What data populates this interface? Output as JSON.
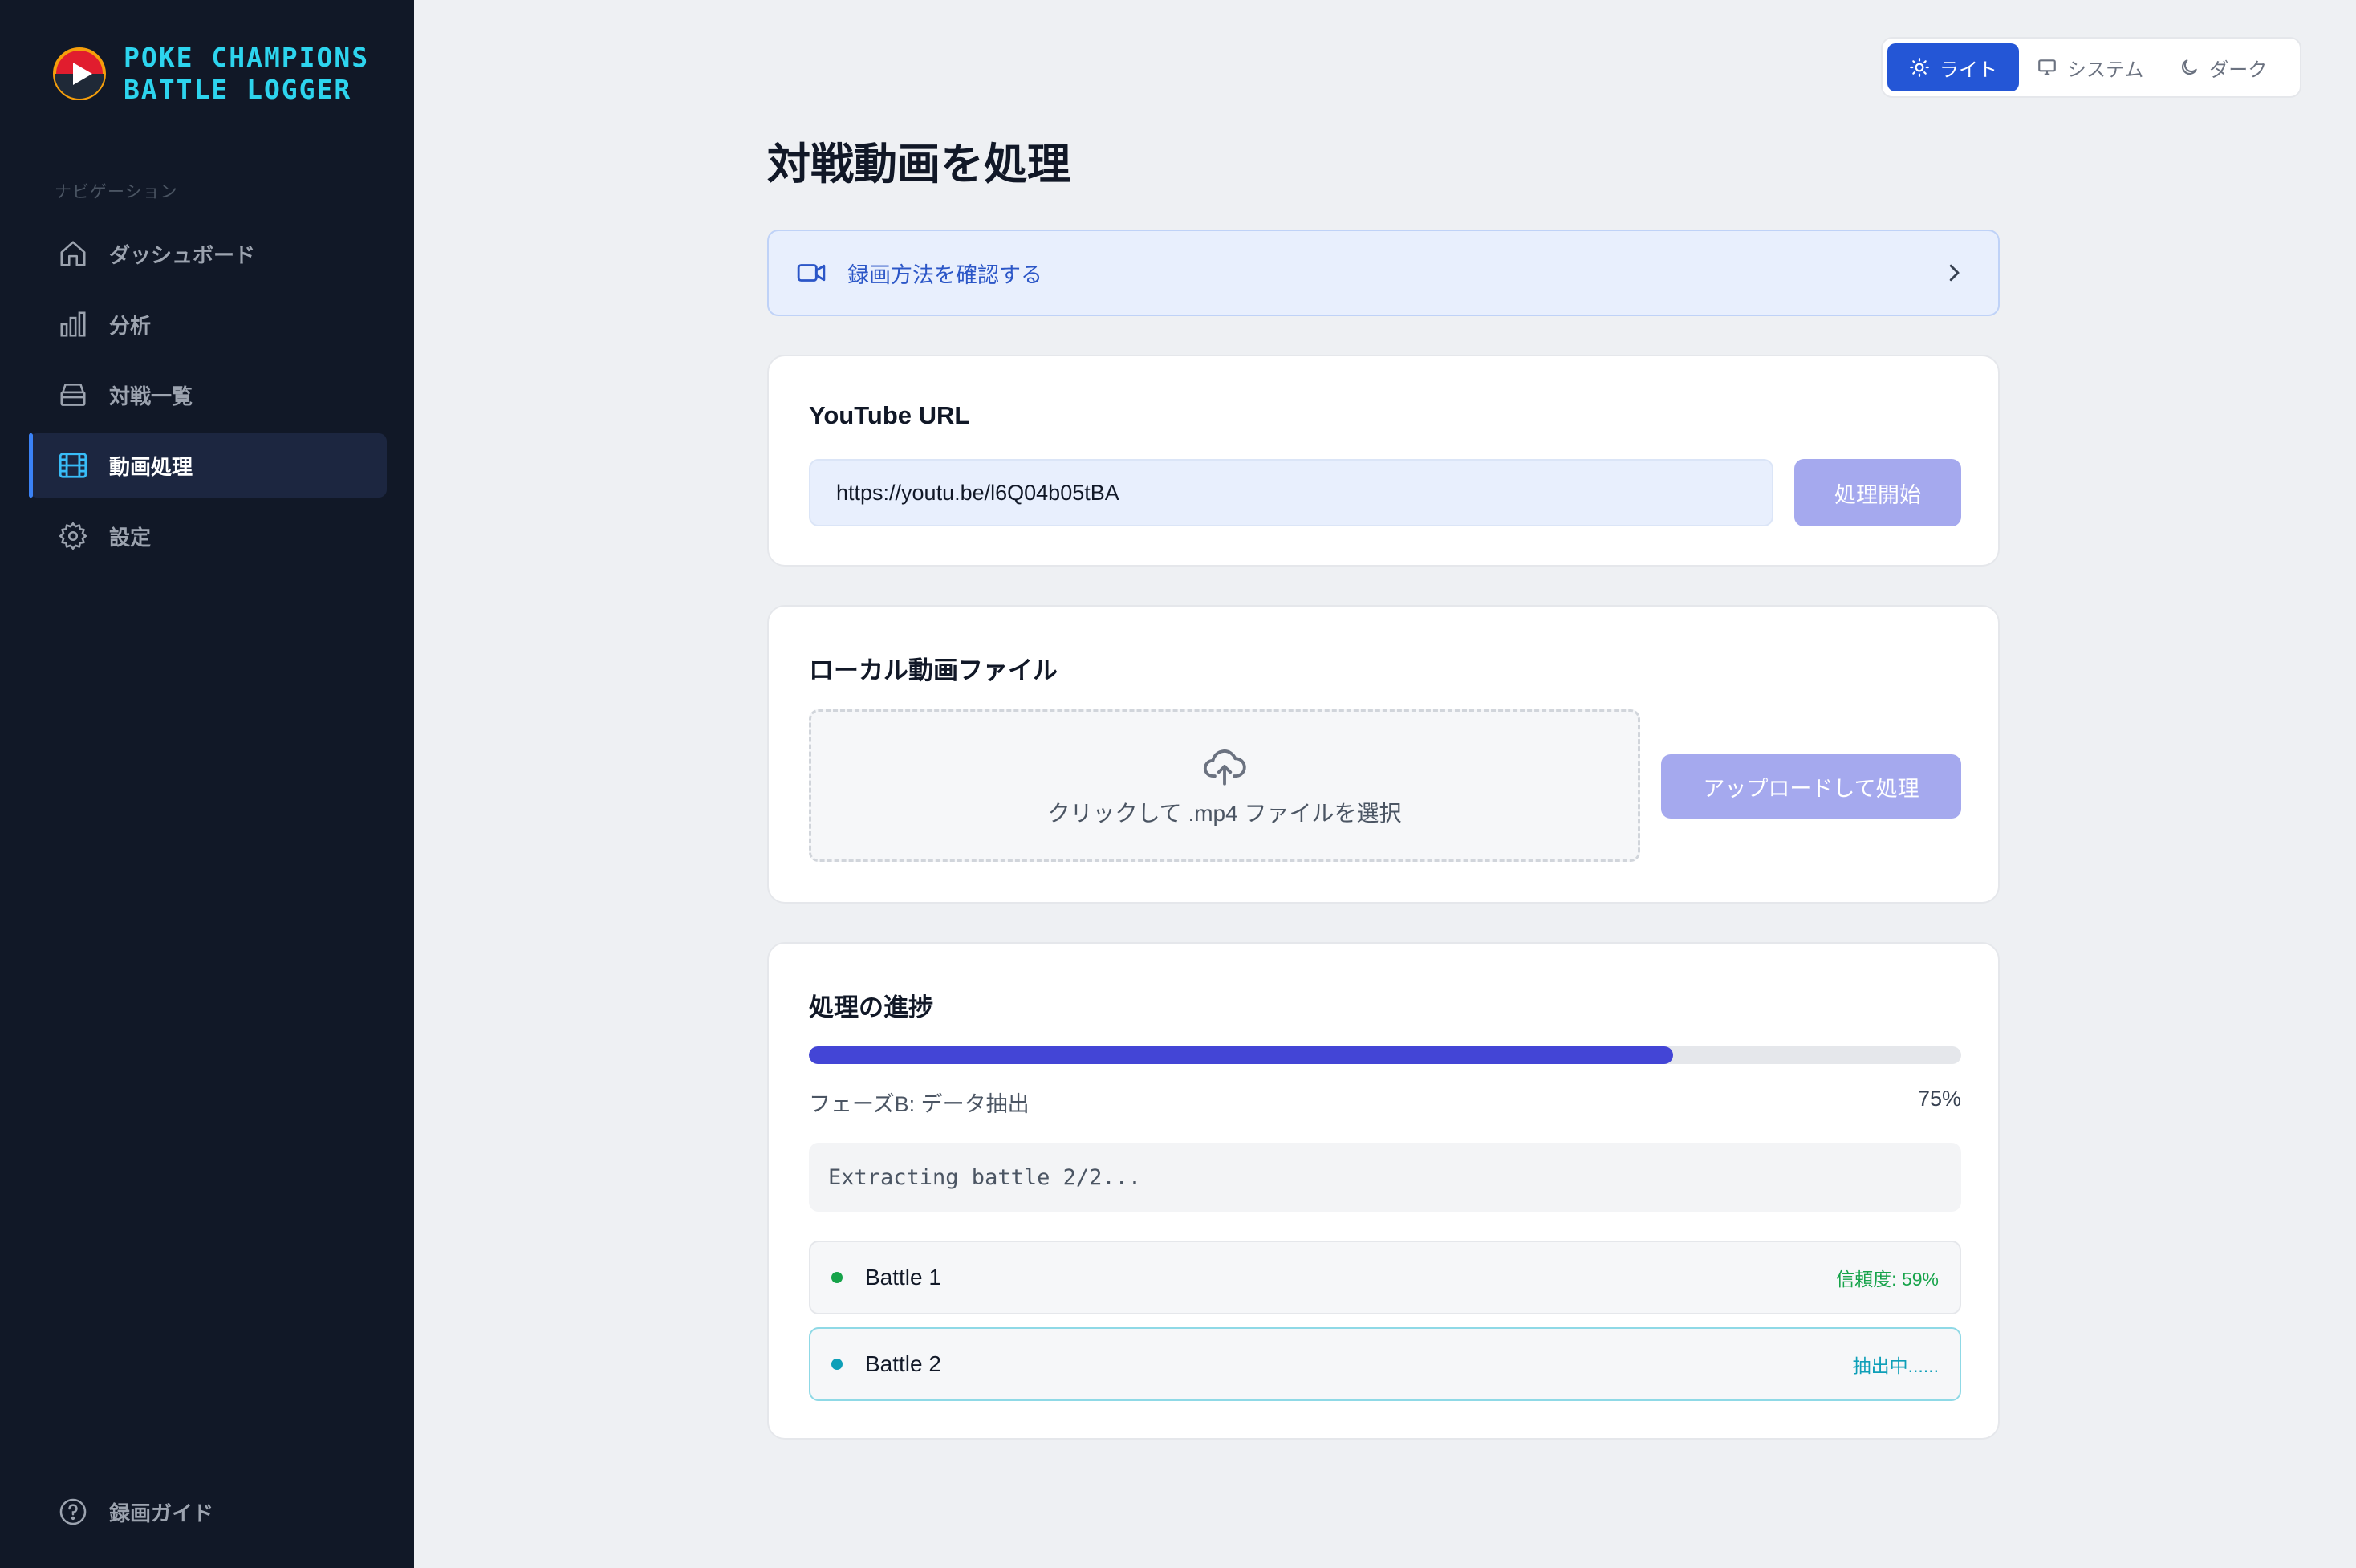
{
  "sidebar": {
    "brand_line1": "POKE CHAMPIONS",
    "brand_line2": "BATTLE LOGGER",
    "nav_heading": "ナビゲーション",
    "items": [
      {
        "label": "ダッシュボード",
        "icon": "home-icon"
      },
      {
        "label": "分析",
        "icon": "bar-chart-icon"
      },
      {
        "label": "対戦一覧",
        "icon": "archive-icon"
      },
      {
        "label": "動画処理",
        "icon": "film-icon",
        "active": true
      },
      {
        "label": "設定",
        "icon": "gear-icon"
      }
    ],
    "guide_label": "録画ガイド",
    "accent": "#2dd4ee"
  },
  "theme": {
    "light": "ライト",
    "system": "システム",
    "dark": "ダーク",
    "selected": "light"
  },
  "main": {
    "title": "対戦動画を処理",
    "rec_banner": "録画方法を確認する",
    "youtube": {
      "title": "YouTube URL",
      "value": "https://youtu.be/l6Q04b05tBA",
      "button": "処理開始"
    },
    "local": {
      "title": "ローカル動画ファイル",
      "dropzone": "クリックして .mp4 ファイルを選択",
      "button": "アップロードして処理"
    },
    "progress": {
      "title": "処理の進捗",
      "phase": "フェーズB: データ抽出",
      "percent": 75,
      "percent_label": "75%",
      "log": "Extracting battle 2/2...",
      "battles": [
        {
          "name": "Battle 1",
          "status": "信頼度: 59%",
          "color": "#16a34a"
        },
        {
          "name": "Battle 2",
          "status": "抽出中......",
          "color": "#0e9fb8"
        }
      ]
    }
  },
  "colors": {
    "sidebar_bg": "#111827",
    "primary": "#2456d6",
    "progress": "#4345d6",
    "button_disabled": "#a5a9ee"
  }
}
